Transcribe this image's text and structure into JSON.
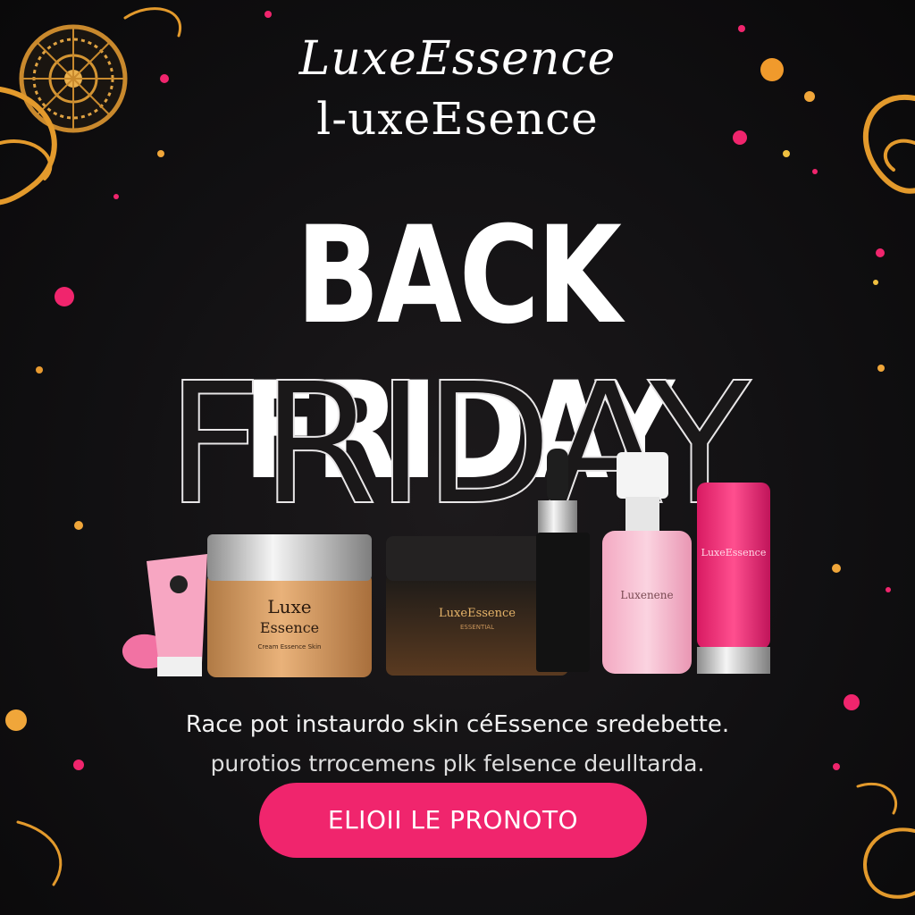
{
  "brand": {
    "primary": "LuxeEssence",
    "secondary": "l-uxeEsence"
  },
  "hero": {
    "headline": "BACK FRIDAY",
    "outline_word": "FRIDAY"
  },
  "products": {
    "tube_label": "",
    "jar_gold_line1": "Luxe",
    "jar_gold_line2": "Essence",
    "jar_gold_sub": "Cream Essence Skin",
    "jar_black_line1": "LuxeEssence",
    "jar_black_line2": "ESSENTIAL",
    "pump_label": "Luxenene",
    "bottle_label": "LuxeEssence"
  },
  "copy": {
    "line1": "Race pot instaurdo skin céEssence sredebette.",
    "line2": "purotios trrocemens plk felsence deulltarda."
  },
  "cta": {
    "label": "ELIOII LE PRONOTO"
  },
  "colors": {
    "background": "#0f0d0e",
    "accent_pink": "#f0256d",
    "gold": "#e8a23a",
    "text": "#ffffff"
  }
}
